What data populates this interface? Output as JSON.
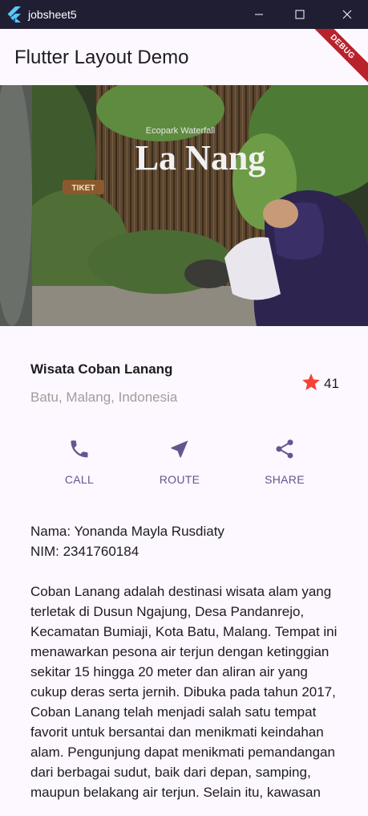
{
  "window": {
    "title": "jobsheet5"
  },
  "appbar": {
    "title": "Flutter Layout Demo",
    "debug_label": "DEBUG"
  },
  "title_section": {
    "name": "Wisata Coban Lanang",
    "location": "Batu, Malang, Indonesia",
    "favorite_count": "41"
  },
  "buttons": [
    {
      "label": "CALL",
      "icon": "phone-icon"
    },
    {
      "label": "ROUTE",
      "icon": "near-me-icon"
    },
    {
      "label": "SHARE",
      "icon": "share-icon"
    }
  ],
  "text_section": {
    "nama": "Nama: Yonanda Mayla Rusdiaty",
    "nim": "NIM: 2341760184",
    "description": "Coban Lanang adalah destinasi wisata alam yang terletak di Dusun Ngajung, Desa Pandanrejo, Kecamatan Bumiaji, Kota Batu, Malang. Tempat ini menawarkan pesona air terjun dengan ketinggian sekitar 15 hingga 20 meter dan aliran air yang cukup deras serta jernih. Dibuka pada tahun 2017, Coban Lanang telah menjadi salah satu tempat favorit untuk bersantai dan menikmati keindahan alam. Pengunjung dapat menikmati pemandangan dari berbagai sudut, baik dari depan, samping, maupun belakang air terjun. Selain itu, kawasan"
  },
  "colors": {
    "primary": "#65558f",
    "star": "#f44336",
    "background": "#fdf7ff",
    "titlebar": "#1f1e33",
    "debug": "#b8222b",
    "location_text": "#9e9e9e"
  },
  "hero_image": {
    "sign_text": "La Nang",
    "sign_subtitle": "Ecopark Waterfall",
    "ticket_sign": "TIKET"
  }
}
